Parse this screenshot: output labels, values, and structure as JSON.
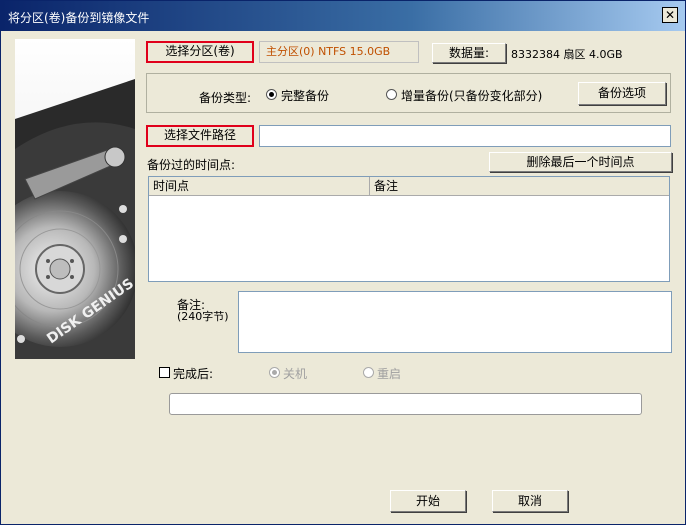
{
  "window": {
    "title": "将分区(卷)备份到镜像文件"
  },
  "partition": {
    "select_button": "选择分区(卷)",
    "value": "主分区(0) NTFS 15.0GB",
    "data_amount_label": "数据量:",
    "data_amount_value": "8332384 扇区  4.0GB"
  },
  "backup_type": {
    "label": "备份类型:",
    "options": [
      {
        "label": "完整备份",
        "selected": true
      },
      {
        "label": "增量备份(只备份变化部分)",
        "selected": false
      }
    ],
    "options_button": "备份选项"
  },
  "file_path": {
    "select_button": "选择文件路径",
    "value": ""
  },
  "timepoints": {
    "label": "备份过的时间点:",
    "delete_button": "删除最后一个时间点",
    "columns": [
      "时间点",
      "备注"
    ],
    "rows": []
  },
  "note": {
    "label": "备注:",
    "hint": "(240字节)",
    "value": ""
  },
  "after_done": {
    "label": "完成后:",
    "checked": false,
    "options": [
      {
        "label": "关机",
        "selected": true,
        "enabled": false
      },
      {
        "label": "重启",
        "selected": false,
        "enabled": false
      }
    ]
  },
  "progress": {
    "fraction": 0
  },
  "footer": {
    "start_button": "开始",
    "cancel_button": "取消"
  },
  "colors": {
    "highlight_border": "#e0001b",
    "partition_text": "#c05000",
    "titlebar": "#0a246a"
  }
}
